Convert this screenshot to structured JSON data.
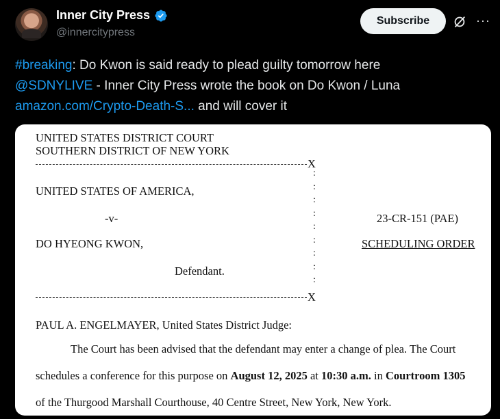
{
  "author": {
    "name": "Inner City Press",
    "handle": "@innercitypress",
    "verified_icon": "verified-badge-icon"
  },
  "actions": {
    "subscribe_label": "Subscribe",
    "grok_icon": "grok-icon",
    "more_icon": "more-icon",
    "more_glyph": "···"
  },
  "tweet": {
    "hashtag": "#breaking",
    "line1_rest": ": Do Kwon is said ready to plead guilty tomorrow here",
    "mention": "@SDNYLIVE",
    "line2_rest": " - Inner City Press wrote the book on Do Kwon / Luna",
    "link_text": "amazon.com/Crypto-Death-S...",
    "line3_rest": " and will cover it"
  },
  "document": {
    "court_line1": "UNITED STATES DISTRICT COURT",
    "court_line2": "SOUTHERN DISTRICT OF NEW YORK",
    "x_mark": "X",
    "plaintiff": "UNITED STATES OF AMERICA,",
    "versus": "-v-",
    "case_number": "23-CR-151 (PAE)",
    "defendant_name": "DO HYEONG KWON,",
    "doc_title": "SCHEDULING ORDER",
    "defendant_label": "Defendant.",
    "colons": ":\n:\n:\n:\n:\n:\n:\n:\n:",
    "judge_line": "PAUL A. ENGELMAYER, United States District Judge:",
    "para_line1": "The Court has been advised that the defendant may enter a change of plea.  The Court",
    "para_line2_a": "schedules a conference for this purpose on ",
    "para_line2_date": "August 12, 2025",
    "para_line2_b": " at ",
    "para_line2_time": "10:30 a.m.",
    "para_line2_c": " in ",
    "para_line2_room": "Courtroom 1305",
    "para_line3": "of the Thurgood Marshall Courthouse, 40 Centre Street, New York, New York."
  },
  "colors": {
    "link": "#1d9bf0",
    "background": "#000000",
    "verified": "#1d9bf0"
  }
}
